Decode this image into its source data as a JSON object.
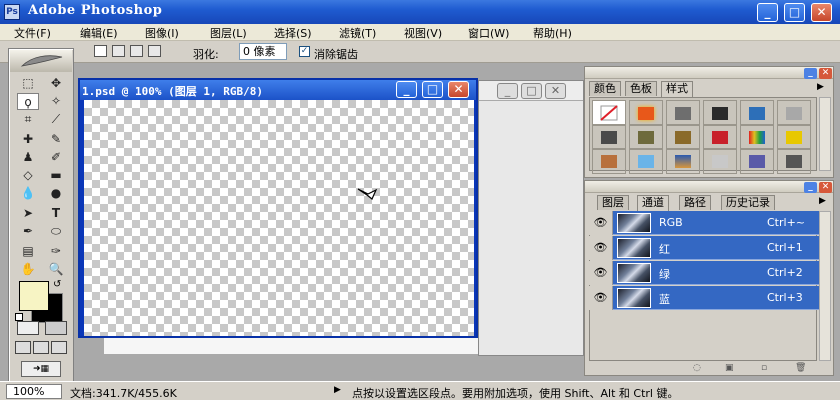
{
  "app": {
    "title": "Adobe Photoshop",
    "icon_name": "photoshop-app-icon",
    "window_controls": {
      "minimize": "_",
      "maximize": "□",
      "close": "✕"
    }
  },
  "menu": {
    "items": [
      "文件(F)",
      "编辑(E)",
      "图像(I)",
      "图层(L)",
      "选择(S)",
      "滤镜(T)",
      "视图(V)",
      "窗口(W)",
      "帮助(H)"
    ]
  },
  "options_bar": {
    "feather_label": "羽化:",
    "feather_value": "0 像素",
    "antialias_label": "消除锯齿",
    "antialias_checked": true
  },
  "document": {
    "title": "1.psd @ 100% (图层 1, RGB/8)",
    "controls": {
      "minimize": "_",
      "maximize": "□",
      "close": "✕"
    }
  },
  "palettes": {
    "top": {
      "tabs": [
        "颜色",
        "色板",
        "样式"
      ],
      "active_tab": "样式",
      "styles": [
        {
          "name": "no-style",
          "color": "#ffffff"
        },
        {
          "name": "orange-glow",
          "color": "#e8581a"
        },
        {
          "name": "gray-bevel",
          "color": "#6e6e6e"
        },
        {
          "name": "black-chrome",
          "color": "#2a2a2a"
        },
        {
          "name": "blue-glass",
          "color": "#2d6fb8"
        },
        {
          "name": "silver",
          "color": "#a8a8a8"
        },
        {
          "name": "dark-steel",
          "color": "#4a4a4a"
        },
        {
          "name": "olive-metal",
          "color": "#6e6a3c"
        },
        {
          "name": "gold-brown",
          "color": "#8a6a2a"
        },
        {
          "name": "red-gel",
          "color": "#c8202a"
        },
        {
          "name": "rainbow",
          "color": "#c83c78"
        },
        {
          "name": "yellow-gem",
          "color": "#e8c800"
        },
        {
          "name": "copper",
          "color": "#b8703c"
        },
        {
          "name": "sky-blue",
          "color": "#6ab4e8"
        },
        {
          "name": "sunset",
          "color": "#d8963c"
        },
        {
          "name": "granite",
          "color": "#c8c8c8"
        },
        {
          "name": "purple-metal",
          "color": "#5a5aa8"
        },
        {
          "name": "charcoal",
          "color": "#555555"
        }
      ]
    },
    "bottom": {
      "tabs": [
        "图层",
        "通道",
        "路径",
        "历史记录"
      ],
      "active_tab": "通道",
      "channels": [
        {
          "name": "RGB",
          "shortcut": "Ctrl+~"
        },
        {
          "name": "红",
          "shortcut": "Ctrl+1"
        },
        {
          "name": "绿",
          "shortcut": "Ctrl+2"
        },
        {
          "name": "蓝",
          "shortcut": "Ctrl+3"
        }
      ]
    }
  },
  "tools": [
    "marquee-tool",
    "move-tool",
    "lasso-tool",
    "magic-wand-tool",
    "crop-tool",
    "slice-tool",
    "healing-brush-tool",
    "brush-tool",
    "clone-stamp-tool",
    "history-brush-tool",
    "eraser-tool",
    "gradient-tool",
    "blur-tool",
    "dodge-tool",
    "path-selection-tool",
    "type-tool",
    "pen-tool",
    "shape-tool",
    "notes-tool",
    "eyedropper-tool",
    "hand-tool",
    "zoom-tool"
  ],
  "colors": {
    "foreground": "#f7f4c4",
    "background": "#000000",
    "title_blue": "#1f5bd0",
    "selection_blue": "#3468c3"
  },
  "status": {
    "zoom": "100%",
    "doc_size": "文档:341.7K/455.6K",
    "hint": "点按以设置选区段点。要用附加选项，使用 Shift、Alt 和 Ctrl 键。"
  }
}
